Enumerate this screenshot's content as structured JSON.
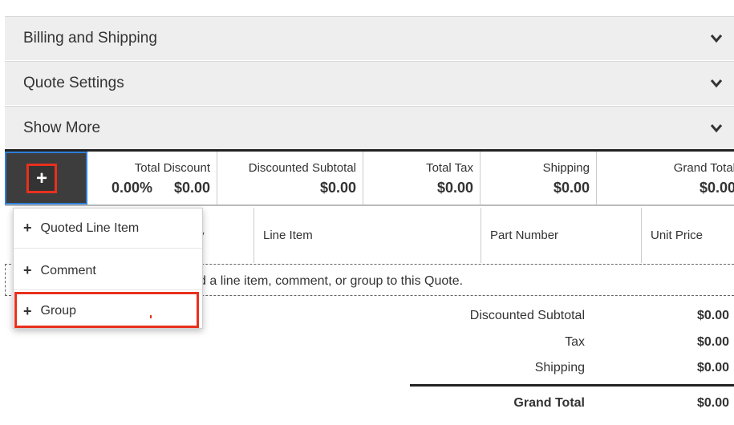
{
  "panels": [
    {
      "title": "Billing and Shipping"
    },
    {
      "title": "Quote Settings"
    },
    {
      "title": "Show More"
    }
  ],
  "totals": {
    "add_button_symbol": "+",
    "total_discount": {
      "label": "Total Discount",
      "percent": "0.00%",
      "value": "$0.00"
    },
    "discounted_subtotal": {
      "label": "Discounted Subtotal",
      "value": "$0.00"
    },
    "total_tax": {
      "label": "Total Tax",
      "value": "$0.00"
    },
    "shipping": {
      "label": "Shipping",
      "value": "$0.00"
    },
    "grand_total": {
      "label": "Grand Total",
      "value": "$0.00"
    }
  },
  "table": {
    "headers": {
      "quantity_partial": "y",
      "line_item": "Line Item",
      "part_number": "Part Number",
      "unit_price": "Unit Price"
    },
    "empty_message_partial": "d a line item, comment, or group to this Quote."
  },
  "summary": [
    {
      "label": "Discounted Subtotal",
      "value": "$0.00"
    },
    {
      "label": "Tax",
      "value": "$0.00"
    },
    {
      "label": "Shipping",
      "value": "$0.00"
    },
    {
      "label": "Grand Total",
      "value": "$0.00"
    }
  ],
  "dropdown": {
    "items": [
      {
        "icon": "plus-icon",
        "label": "Quoted Line Item"
      },
      {
        "icon": "plus-icon",
        "label": "Comment"
      },
      {
        "icon": "plus-icon",
        "label": "Group"
      }
    ]
  },
  "colors": {
    "highlight": "#e8301d",
    "focus": "#2f7ed8",
    "panel_bg": "#eeeeee",
    "button_bg": "#333333"
  }
}
